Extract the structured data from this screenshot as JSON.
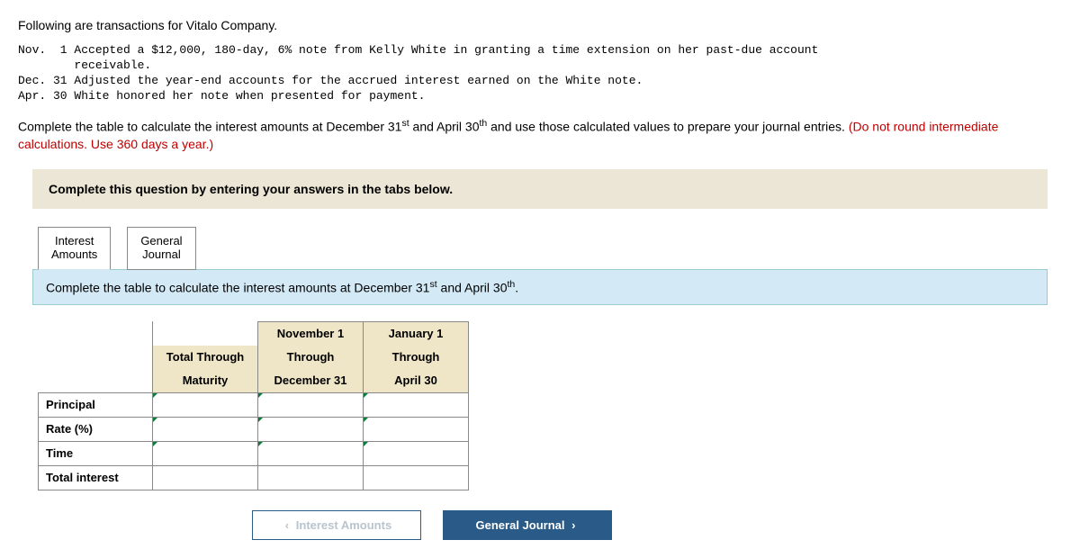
{
  "intro": "Following are transactions for Vitalo Company.",
  "transactions": "Nov.  1 Accepted a $12,000, 180-day, 6% note from Kelly White in granting a time extension on her past-due account\n        receivable.\nDec. 31 Adjusted the year-end accounts for the accrued interest earned on the White note.\nApr. 30 White honored her note when presented for payment.",
  "instr_part1": "Complete the table to calculate the interest amounts at December 31",
  "instr_sup1": "st",
  "instr_part2": " and April 30",
  "instr_sup2": "th",
  "instr_part3": " and use those calculated values to prepare your journal entries. ",
  "instr_red": "(Do not round intermediate calculations. Use 360 days a year.)",
  "band": "Complete this question by entering your answers in the tabs below.",
  "tabs": {
    "interest": "Interest\nAmounts",
    "journal": "General\nJournal"
  },
  "subprompt_part1": "Complete the table to calculate the interest amounts at December 31",
  "subprompt_sup1": "st",
  "subprompt_part2": " and April 30",
  "subprompt_sup2": "th",
  "subprompt_part3": ".",
  "cols": {
    "c1a": "Total Through",
    "c1b": "Maturity",
    "c2a": "November 1",
    "c2b": "Through",
    "c2c": "December 31",
    "c3a": "January 1",
    "c3b": "Through",
    "c3c": "April 30"
  },
  "rows": {
    "principal": "Principal",
    "rate": "Rate (%)",
    "time": "Time",
    "total": "Total interest"
  },
  "nav": {
    "prev": "Interest Amounts",
    "next": "General Journal"
  }
}
